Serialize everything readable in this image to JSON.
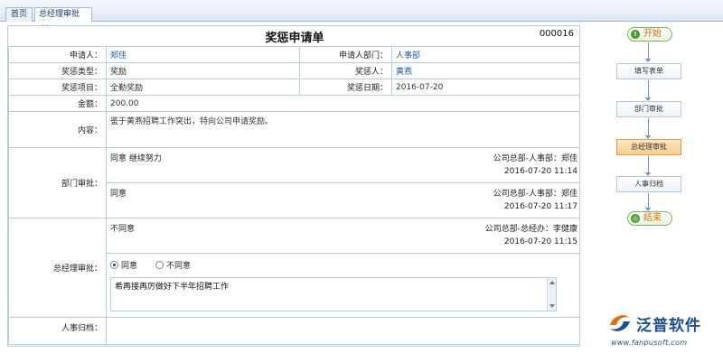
{
  "tabs": [
    {
      "label": "首页"
    },
    {
      "label": "总经理审批",
      "close": "✕"
    }
  ],
  "form": {
    "title": "奖惩申请单",
    "number": "000016",
    "applicant_label": "申请人：",
    "applicant": "郑佳",
    "dept_label": "申请人部门：",
    "dept": "人事部",
    "type_label": "奖惩类型：",
    "type": "奖励",
    "target_label": "奖惩人：",
    "target": "黄燕",
    "item_label": "奖惩项目：",
    "item": "全勤奖励",
    "date_label": "奖惩日期：",
    "date": "2016-07-20",
    "amount_label": "金额：",
    "amount": "200.00",
    "content_label": "内容：",
    "content": "鉴于黄燕招聘工作突出，特向公司申请奖励。",
    "dept_review_label": "部门审批：",
    "dept_reviews": [
      {
        "opinion": "同意  继续努力",
        "who": "公司总部-人事部：郑佳",
        "time": "2016-07-20 11:14"
      },
      {
        "opinion": "同意",
        "who": "公司总部-人事部：郑佳",
        "time": "2016-07-20 11:17"
      }
    ],
    "gm_review_label": "总经理审批：",
    "gm_prev": {
      "opinion": "不同意",
      "who": "公司总部-总经办：李健康",
      "time": "2016-07-20 11:15"
    },
    "gm_options": {
      "agree": "同意",
      "disagree": "不同意",
      "selected": "agree"
    },
    "gm_comment": "希再接再厉做好下半年招聘工作",
    "hr_archive_label": "人事归档："
  },
  "flow": {
    "start": "开始",
    "steps": [
      "填写表单",
      "部门审批",
      "总经理审批",
      "人事归档"
    ],
    "current_step": "总经理审批",
    "end": "结束"
  },
  "watermark": {
    "brand": "泛普软件",
    "url": "www.fanpusoft.com"
  },
  "colors": {
    "border": "#b7cde4",
    "link_blue": "#1f56a8",
    "current_step": "#f7cf8f",
    "brand_blue": "#1c4f8f",
    "start_end_text": "#d06a10"
  }
}
